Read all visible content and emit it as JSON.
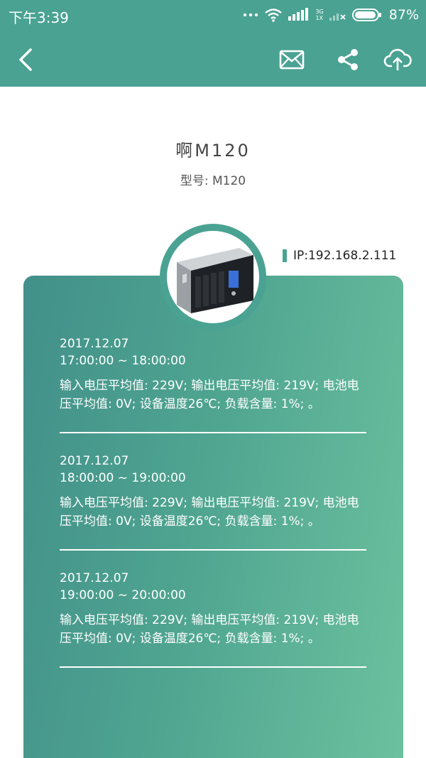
{
  "status": {
    "time": "下午3:39",
    "net_top": "3G",
    "net_bottom": "1X",
    "battery": "87%"
  },
  "nav": {
    "back_icon": "chevron-left-icon",
    "mail_icon": "mail-icon",
    "share_icon": "share-icon",
    "upload_icon": "cloud-upload-icon"
  },
  "device": {
    "name": "啊M120",
    "model_label": "型号: M120",
    "ip": "IP:192.168.2.111"
  },
  "colors": {
    "accent": "#4aa292",
    "card_start": "#42908a",
    "card_end": "#6cc19f"
  },
  "records": [
    {
      "date": "2017.12.07",
      "time": "17:00:00 ~ 18:00:00",
      "text": "输入电压平均值: 229V; 输出电压平均值: 219V; 电池电压平均值: 0V; 设备温度26℃; 负载含量: 1%; 。"
    },
    {
      "date": "2017.12.07",
      "time": "18:00:00 ~ 19:00:00",
      "text": "输入电压平均值: 229V; 输出电压平均值: 219V; 电池电压平均值: 0V; 设备温度26℃; 负载含量: 1%; 。"
    },
    {
      "date": "2017.12.07",
      "time": "19:00:00 ~ 20:00:00",
      "text": "输入电压平均值: 229V; 输出电压平均值: 219V; 电池电压平均值: 0V; 设备温度26℃; 负载含量: 1%; 。"
    }
  ]
}
